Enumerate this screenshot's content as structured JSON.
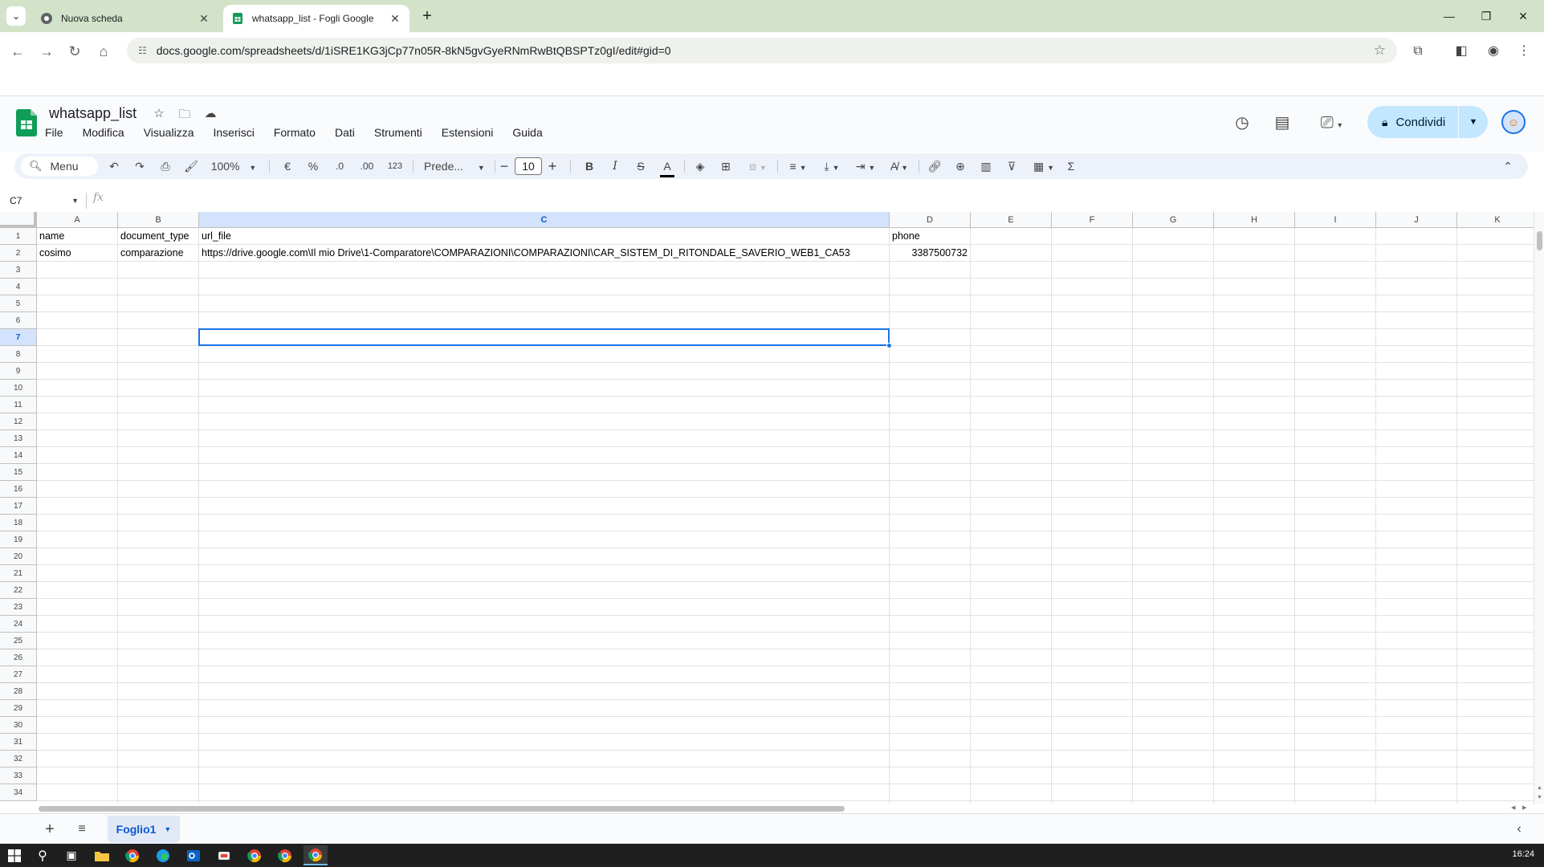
{
  "browser": {
    "tabs": [
      {
        "title": "Nuova scheda",
        "active": false
      },
      {
        "title": "whatsapp_list - Fogli Google",
        "active": true
      }
    ],
    "url": "docs.google.com/spreadsheets/d/1iSRE1KG3jCp77n05R-8kN5gvGyeRNmRwBtQBSPTz0gI/edit#gid=0"
  },
  "app": {
    "title": "whatsapp_list",
    "menus": [
      "File",
      "Modifica",
      "Visualizza",
      "Inserisci",
      "Formato",
      "Dati",
      "Strumenti",
      "Estensioni",
      "Guida"
    ],
    "share_label": "Condividi"
  },
  "toolbar": {
    "menu_label": "Menu",
    "zoom": "100%",
    "currency": "€",
    "percent": "%",
    "dec_decrease": ".0",
    "dec_increase": ".00",
    "number_format": "123",
    "font": "Prede...",
    "font_size": "10"
  },
  "formula_bar": {
    "cell_ref": "C7",
    "fx": "fx"
  },
  "grid": {
    "columns": [
      "A",
      "B",
      "C",
      "D",
      "E",
      "F",
      "G",
      "H",
      "I",
      "J",
      "K"
    ],
    "selected_column": "C",
    "selected_row": 7,
    "selected_cell": "C7",
    "row_count": 34,
    "rows": [
      {
        "A": "name",
        "B": "document_type",
        "C": "url_file",
        "D": "phone"
      },
      {
        "A": "cosimo",
        "B": "comparazione",
        "C": "https://drive.google.com\\Il mio Drive\\1-Comparatore\\COMPARAZIONI\\COMPARAZIONI\\CAR_SISTEM_DI_RITONDALE_SAVERIO_WEB1_CA53",
        "D": "3387500732"
      }
    ]
  },
  "sheet_tabs": [
    {
      "name": "Foglio1",
      "active": true
    }
  ],
  "taskbar": {
    "time": "16:24"
  },
  "colors": {
    "accent": "#1a73e8",
    "share_bg": "#c2e7ff",
    "tabbar_bg": "#d3e3c9",
    "sheets_green": "#0f9d58"
  }
}
